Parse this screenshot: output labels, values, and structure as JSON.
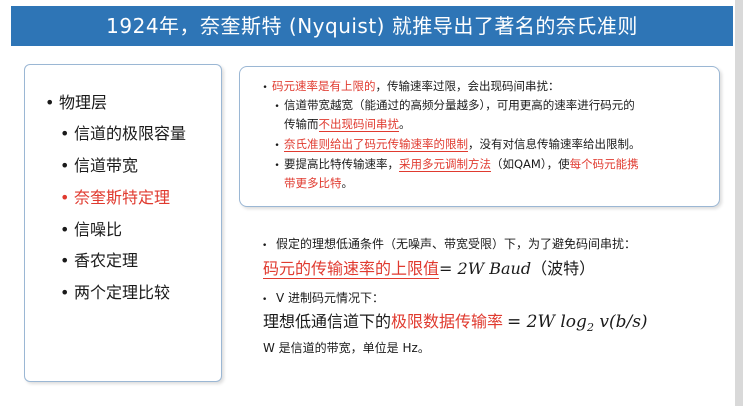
{
  "title": "1924年，奈奎斯特 (Nyquist) 就推导出了著名的奈氏准则",
  "outline": {
    "items": [
      {
        "label": "物理层",
        "level": 0
      },
      {
        "label": "信道的极限容量",
        "level": 1
      },
      {
        "label": "信道带宽",
        "level": 1
      },
      {
        "label": "奈奎斯特定理",
        "level": 1,
        "highlight": true
      },
      {
        "label": "信噪比",
        "level": 1
      },
      {
        "label": "香农定理",
        "level": 1
      },
      {
        "label": "两个定理比较",
        "level": 1
      }
    ]
  },
  "top_box": {
    "b1_red": "码元速率是有上限的",
    "b1_rest": "，传输速率过限，会出现码间串扰：",
    "b2_line1": "信道带宽越宽（能通过的高频分量越多），可用更高的速率进行码元的",
    "b2_line2_pre": "传输而",
    "b2_line2_red": "不出现码间串扰",
    "b2_line2_post": "。",
    "b3_red": "奈氏准则给出了码元传输速率的限制",
    "b3_rest": "，没有对信息传输速率给出限制。",
    "b4_pre": "要提高比特传输速率，",
    "b4_red": "采用多元调制方法",
    "b4_mid": "（如QAM），使",
    "b4_red2": "每个码元能携",
    "b4_line2_red": "带更多比特",
    "b4_line2_post": "。"
  },
  "lower": {
    "assume": "假定的理想低通条件（无噪声、带宽受限）下，为了避免码间串扰：",
    "limit_red": "码元的传输速率的上限值",
    "limit_eq": "= 2W Baud",
    "limit_tail": "（波特）",
    "v_bullet": "V 进制码元情况下：",
    "formula_pre": "理想低通信道下的",
    "formula_red": "极限数据传输率",
    "formula_eq": "= 2W log",
    "formula_sub": "2",
    "formula_tail": " v(b/s)",
    "w_note": "W 是信道的带宽，单位是 Hz。"
  },
  "colors": {
    "title_bg": "#2e75b6",
    "accent_red": "#e03a2f",
    "panel_border": "#9bb7d4"
  }
}
